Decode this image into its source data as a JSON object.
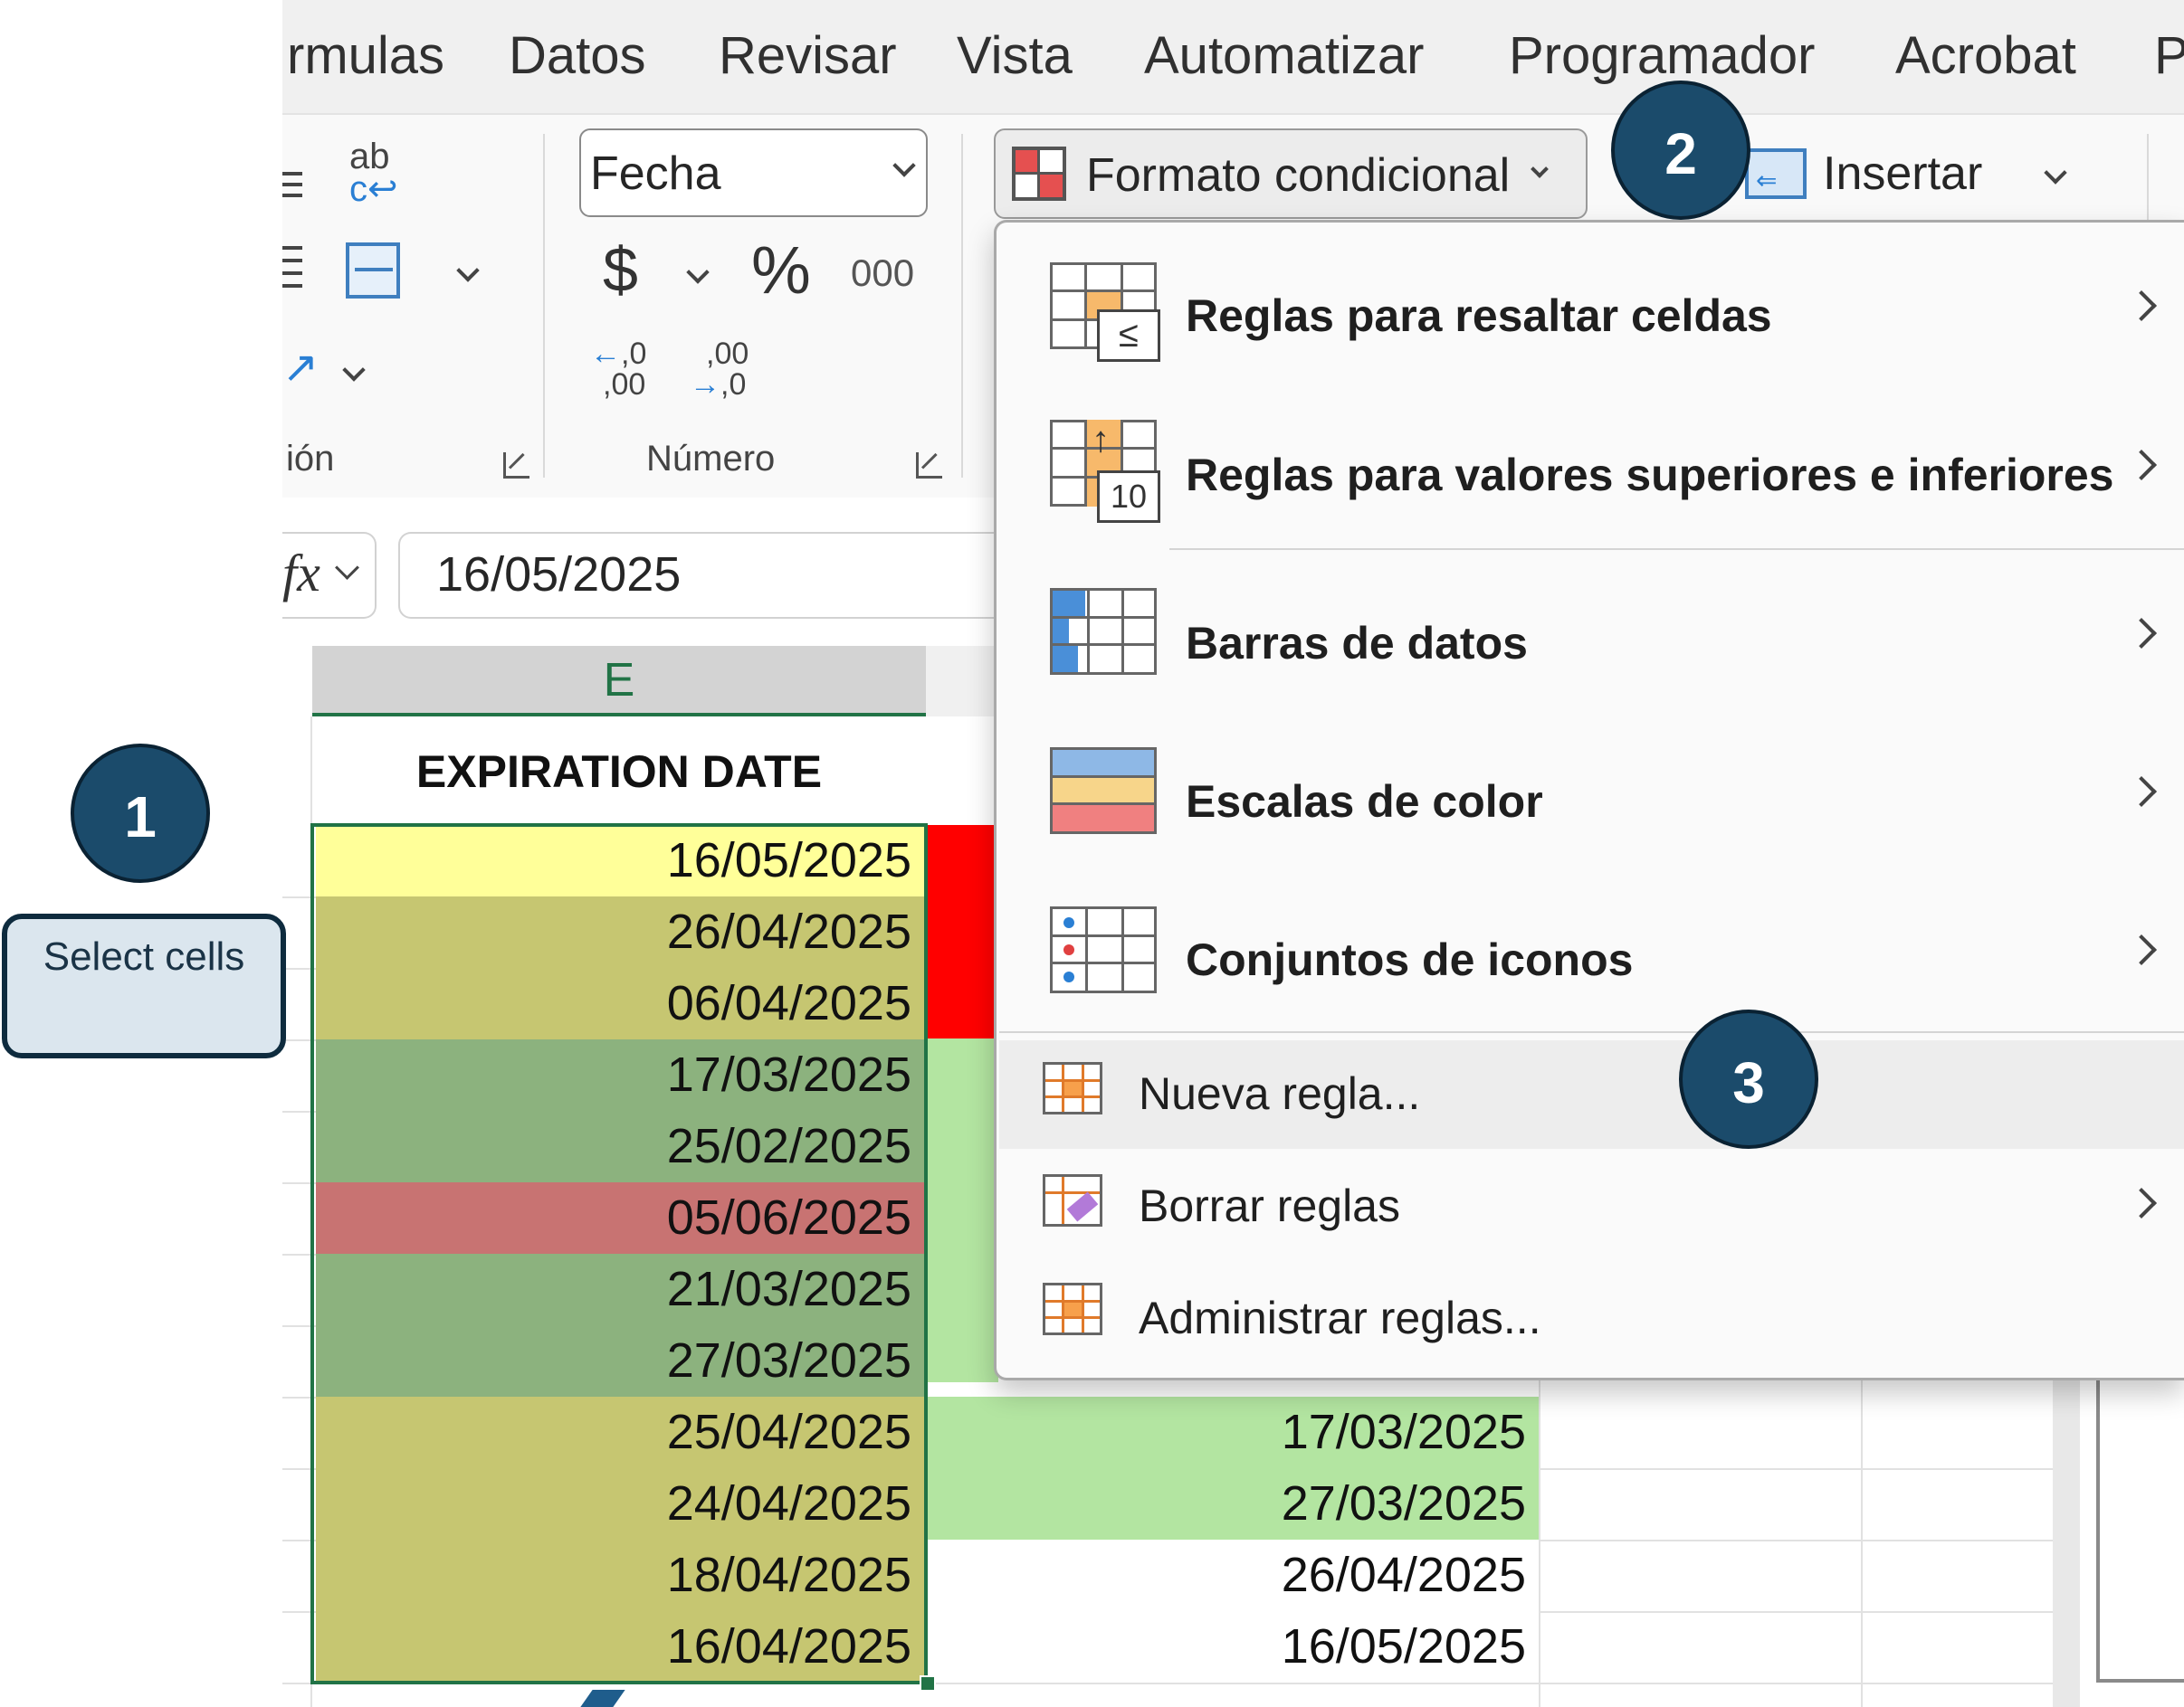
{
  "tabs": [
    "rmulas",
    "Datos",
    "Revisar",
    "Vista",
    "Automatizar",
    "Programador",
    "Acrobat",
    "P"
  ],
  "ribbon": {
    "alignment_group_label": "ión",
    "number_format": "Fecha",
    "number_group_label": "Número",
    "currency_symbol": "$",
    "percent_symbol": "%",
    "thousands_label": "000",
    "conditional_format_label": "Formato condicional",
    "insert_label": "Insertar"
  },
  "formula_bar": {
    "fx_label": "fx",
    "value": "16/05/2025"
  },
  "sheet": {
    "column_header": "E",
    "header": "EXPIRATION DATE",
    "column_e": [
      {
        "value": "16/05/2025",
        "fill": "#ffff99"
      },
      {
        "value": "26/04/2025",
        "fill": "#c6c671"
      },
      {
        "value": "06/04/2025",
        "fill": "#c6c671"
      },
      {
        "value": "17/03/2025",
        "fill": "#8cb27e"
      },
      {
        "value": "25/02/2025",
        "fill": "#8cb27e"
      },
      {
        "value": "05/06/2025",
        "fill": "#c87372"
      },
      {
        "value": "21/03/2025",
        "fill": "#8cb27e"
      },
      {
        "value": "27/03/2025",
        "fill": "#8cb27e"
      },
      {
        "value": "25/04/2025",
        "fill": "#c6c671"
      },
      {
        "value": "24/04/2025",
        "fill": "#c6c671"
      },
      {
        "value": "18/04/2025",
        "fill": "#c6c671"
      },
      {
        "value": "16/04/2025",
        "fill": "#c6c671"
      }
    ],
    "column_f_visible": [
      {
        "value": "17/03/2025",
        "fill": "#b3e5a1"
      },
      {
        "value": "27/03/2025",
        "fill": "#b3e5a1"
      },
      {
        "value": "26/04/2025",
        "fill": "#ffffff"
      },
      {
        "value": "16/05/2025",
        "fill": "#ffffff"
      }
    ]
  },
  "menu": {
    "items_big": [
      {
        "label": "Reglas para resaltar celdas",
        "icon": "highlight-rules-icon"
      },
      {
        "label": "Reglas para valores superiores e inferiores",
        "icon": "top-bottom-rules-icon"
      },
      {
        "label": "Barras de datos",
        "icon": "data-bars-icon"
      },
      {
        "label": "Escalas de color",
        "icon": "color-scales-icon"
      },
      {
        "label": "Conjuntos de iconos",
        "icon": "icon-sets-icon"
      }
    ],
    "items_small": [
      {
        "label": "Nueva regla...",
        "icon": "new-rule-icon"
      },
      {
        "label": "Borrar reglas",
        "icon": "clear-rules-icon"
      },
      {
        "label": "Administrar reglas...",
        "icon": "manage-rules-icon"
      }
    ]
  },
  "callouts": {
    "step1": "1",
    "step1_note": "Select cells",
    "step2": "2",
    "step3": "3"
  },
  "colors": {
    "badge": "#1b4b6b",
    "selection_border": "#217346",
    "red_fill": "#ff0000",
    "green_fill": "#b3e5a1"
  }
}
